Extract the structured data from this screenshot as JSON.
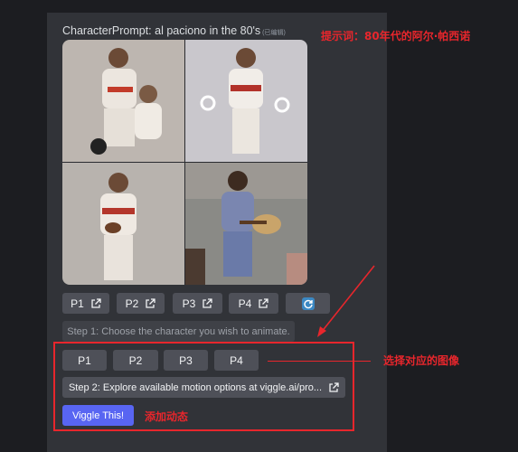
{
  "message": {
    "title": "CharacterPrompt: al paciono in the 80's",
    "edited": "(已编辑)"
  },
  "image_grid": {
    "tiles": [
      "baseball-player-tile",
      "baseball-player-tile",
      "baseball-player-tile",
      "guitar-player-tile"
    ]
  },
  "row1_buttons": [
    {
      "label": "P1"
    },
    {
      "label": "P2"
    },
    {
      "label": "P3"
    },
    {
      "label": "P4"
    }
  ],
  "refresh_icon": "refresh-icon",
  "step1": "Step 1: Choose the character you wish to animate.",
  "row2_buttons": [
    {
      "label": "P1"
    },
    {
      "label": "P2"
    },
    {
      "label": "P3"
    },
    {
      "label": "P4"
    }
  ],
  "step2": "Step 2: Explore available motion options at viggle.ai/pro...",
  "viggle_button": "Viggle This!",
  "annotations": {
    "prompt_note": "提示词：80年代的阿尔·帕西诺",
    "select_note": "选择对应的图像",
    "animate_note": "添加动态"
  },
  "colors": {
    "accent": "#5865f2",
    "annotation": "#e8262c",
    "button": "#4e5058",
    "background": "#313338"
  }
}
